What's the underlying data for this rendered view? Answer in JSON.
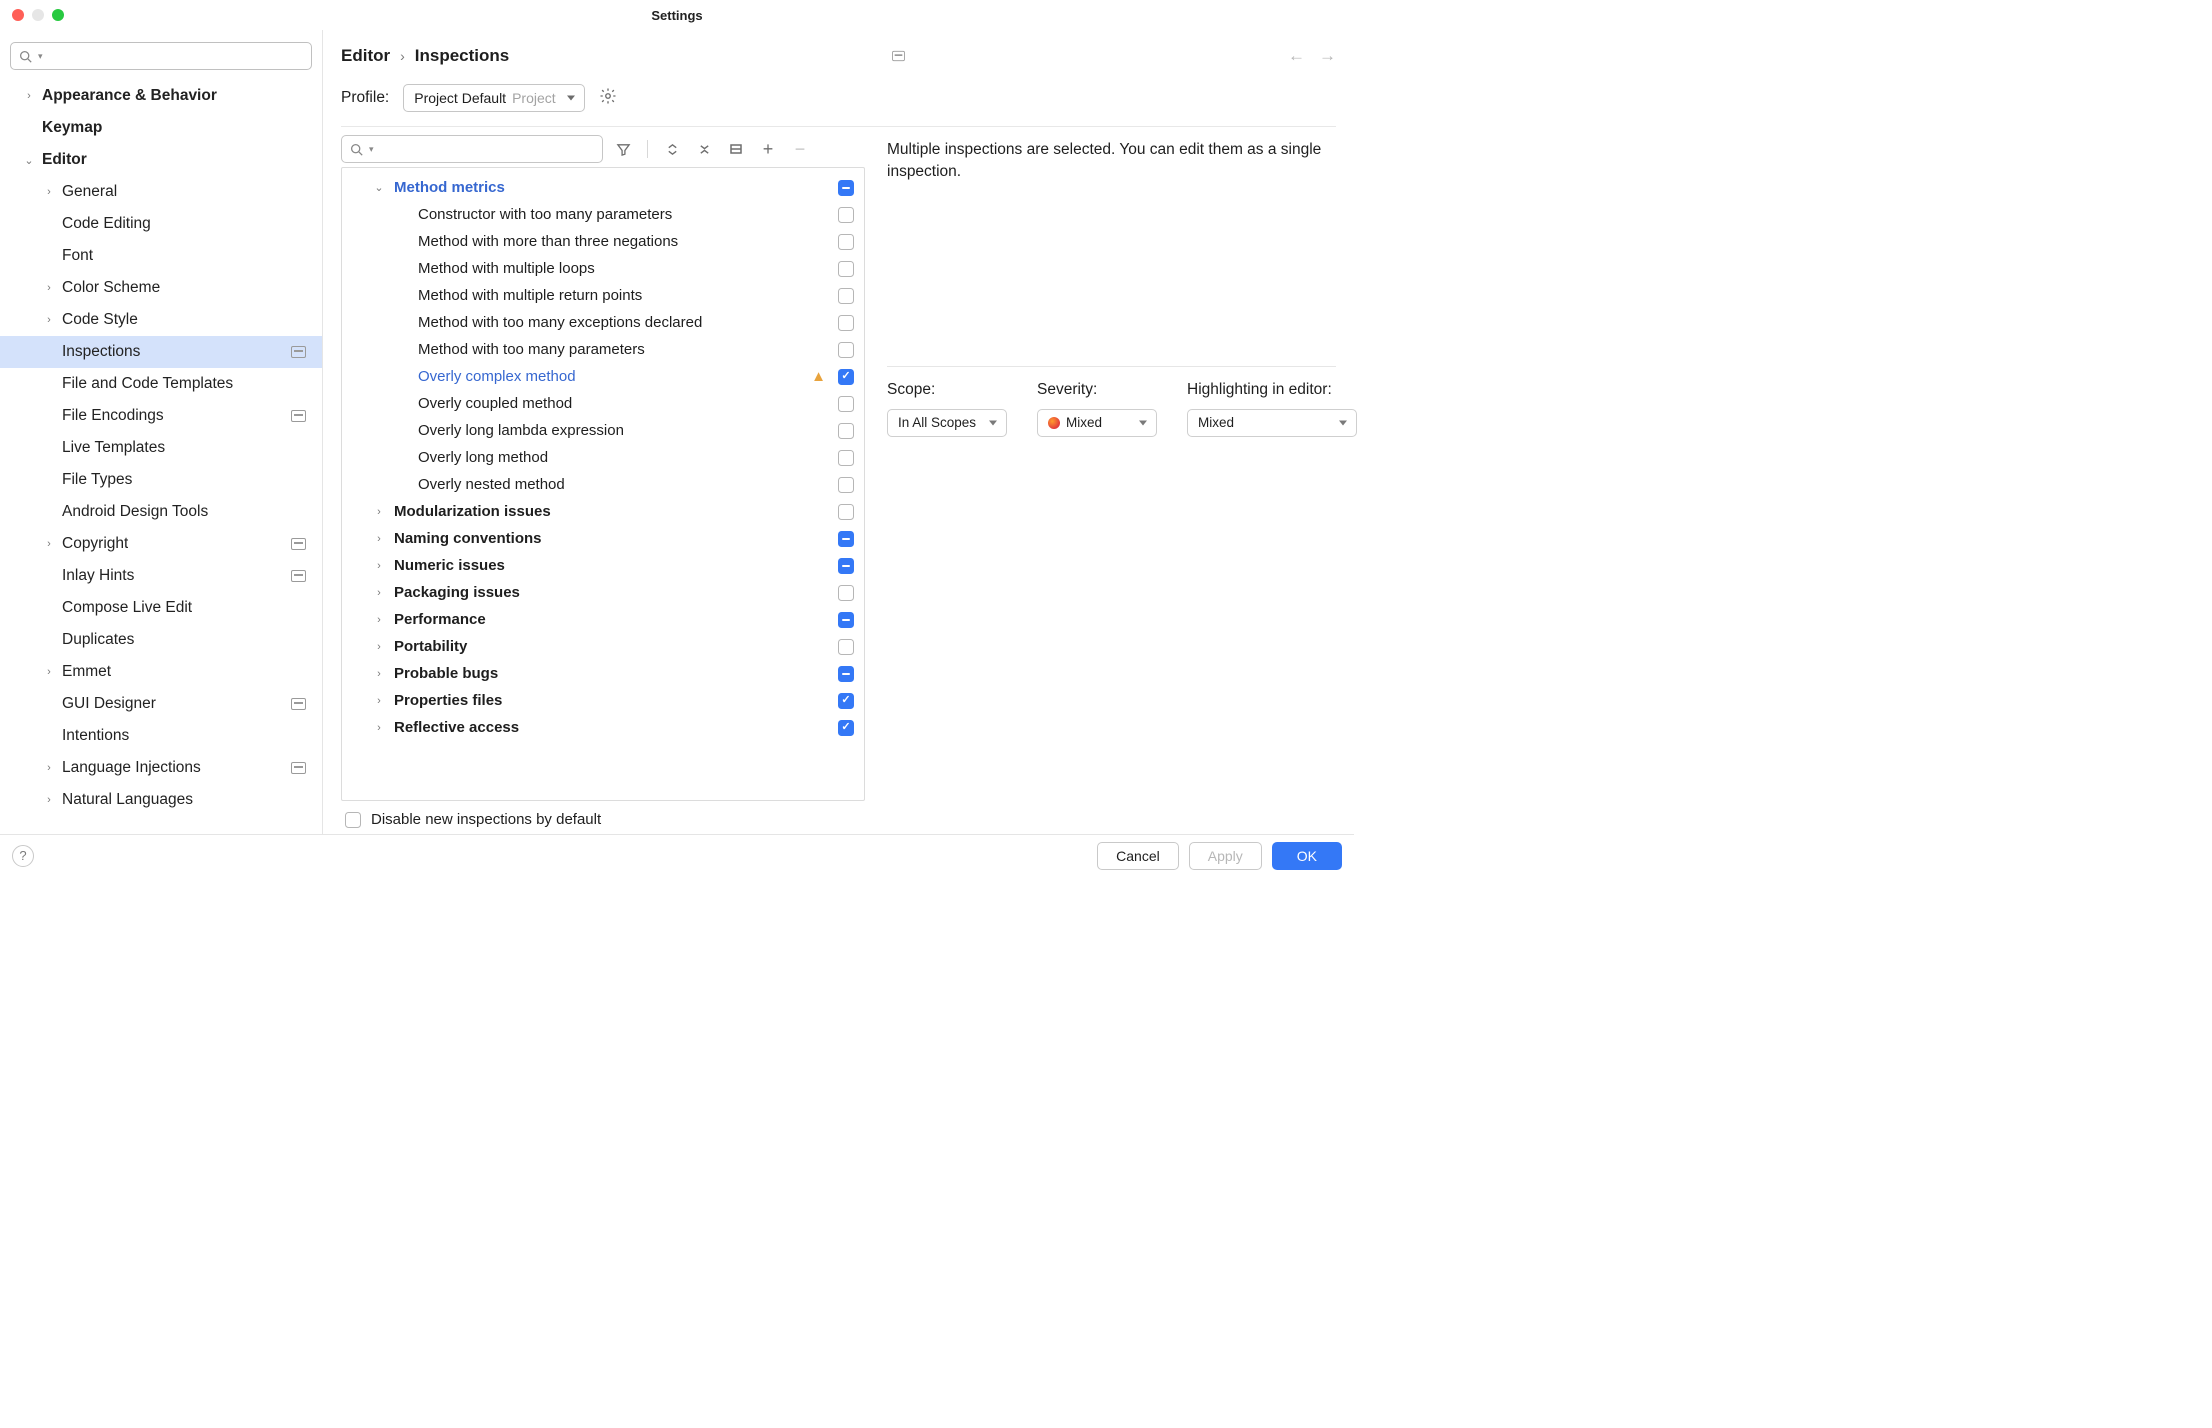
{
  "window": {
    "title": "Settings"
  },
  "sidebar": {
    "search_placeholder": "",
    "items": [
      {
        "label": "Appearance & Behavior",
        "depth": 0,
        "arrow": "right",
        "bold": true
      },
      {
        "label": "Keymap",
        "depth": 0,
        "arrow": "none",
        "bold": true
      },
      {
        "label": "Editor",
        "depth": 0,
        "arrow": "down",
        "bold": true
      },
      {
        "label": "General",
        "depth": 1,
        "arrow": "right"
      },
      {
        "label": "Code Editing",
        "depth": 1,
        "arrow": "none"
      },
      {
        "label": "Font",
        "depth": 1,
        "arrow": "none"
      },
      {
        "label": "Color Scheme",
        "depth": 1,
        "arrow": "right"
      },
      {
        "label": "Code Style",
        "depth": 1,
        "arrow": "right"
      },
      {
        "label": "Inspections",
        "depth": 1,
        "arrow": "none",
        "selected": true,
        "proj": true
      },
      {
        "label": "File and Code Templates",
        "depth": 1,
        "arrow": "none"
      },
      {
        "label": "File Encodings",
        "depth": 1,
        "arrow": "none",
        "proj": true
      },
      {
        "label": "Live Templates",
        "depth": 1,
        "arrow": "none"
      },
      {
        "label": "File Types",
        "depth": 1,
        "arrow": "none"
      },
      {
        "label": "Android Design Tools",
        "depth": 1,
        "arrow": "none"
      },
      {
        "label": "Copyright",
        "depth": 1,
        "arrow": "right",
        "proj": true
      },
      {
        "label": "Inlay Hints",
        "depth": 1,
        "arrow": "none",
        "proj": true
      },
      {
        "label": "Compose Live Edit",
        "depth": 1,
        "arrow": "none"
      },
      {
        "label": "Duplicates",
        "depth": 1,
        "arrow": "none"
      },
      {
        "label": "Emmet",
        "depth": 1,
        "arrow": "right"
      },
      {
        "label": "GUI Designer",
        "depth": 1,
        "arrow": "none",
        "proj": true
      },
      {
        "label": "Intentions",
        "depth": 1,
        "arrow": "none"
      },
      {
        "label": "Language Injections",
        "depth": 1,
        "arrow": "right",
        "proj": true
      },
      {
        "label": "Natural Languages",
        "depth": 1,
        "arrow": "right"
      }
    ]
  },
  "breadcrumb": {
    "a": "Editor",
    "b": "Inspections"
  },
  "profile": {
    "label": "Profile:",
    "value": "Project Default",
    "scope": "Project"
  },
  "inspections_search_placeholder": "",
  "inspections": [
    {
      "label": "Method metrics",
      "kind": "cat",
      "arrow": "down",
      "blue": true,
      "depth": 0,
      "state": "indet"
    },
    {
      "label": "Constructor with too many parameters",
      "depth": 1,
      "state": "off"
    },
    {
      "label": "Method with more than three negations",
      "depth": 1,
      "state": "off"
    },
    {
      "label": "Method with multiple loops",
      "depth": 1,
      "state": "off"
    },
    {
      "label": "Method with multiple return points",
      "depth": 1,
      "state": "off"
    },
    {
      "label": "Method with too many exceptions declared",
      "depth": 1,
      "state": "off"
    },
    {
      "label": "Method with too many parameters",
      "depth": 1,
      "state": "off"
    },
    {
      "label": "Overly complex method",
      "depth": 1,
      "state": "on",
      "blue": true,
      "warn": true
    },
    {
      "label": "Overly coupled method",
      "depth": 1,
      "state": "off"
    },
    {
      "label": "Overly long lambda expression",
      "depth": 1,
      "state": "off"
    },
    {
      "label": "Overly long method",
      "depth": 1,
      "state": "off"
    },
    {
      "label": "Overly nested method",
      "depth": 1,
      "state": "off"
    },
    {
      "label": "Modularization issues",
      "kind": "cat",
      "arrow": "right",
      "depth": 0,
      "state": "off"
    },
    {
      "label": "Naming conventions",
      "kind": "cat",
      "arrow": "right",
      "depth": 0,
      "state": "indet"
    },
    {
      "label": "Numeric issues",
      "kind": "cat",
      "arrow": "right",
      "depth": 0,
      "state": "indet"
    },
    {
      "label": "Packaging issues",
      "kind": "cat",
      "arrow": "right",
      "depth": 0,
      "state": "off"
    },
    {
      "label": "Performance",
      "kind": "cat",
      "arrow": "right",
      "depth": 0,
      "state": "indet"
    },
    {
      "label": "Portability",
      "kind": "cat",
      "arrow": "right",
      "depth": 0,
      "state": "off"
    },
    {
      "label": "Probable bugs",
      "kind": "cat",
      "arrow": "right",
      "depth": 0,
      "state": "indet"
    },
    {
      "label": "Properties files",
      "kind": "cat",
      "arrow": "right",
      "depth": 0,
      "state": "on"
    },
    {
      "label": "Reflective access",
      "kind": "cat",
      "arrow": "right",
      "depth": 0,
      "state": "on"
    }
  ],
  "disable_new_default": {
    "label": "Disable new inspections by default",
    "checked": false
  },
  "detail_message": "Multiple inspections are selected. You can edit them as a single inspection.",
  "controls": {
    "scope": {
      "label": "Scope:",
      "value": "In All Scopes"
    },
    "severity": {
      "label": "Severity:",
      "value": "Mixed"
    },
    "highlighting": {
      "label": "Highlighting in editor:",
      "value": "Mixed"
    }
  },
  "footer": {
    "cancel": "Cancel",
    "apply": "Apply",
    "ok": "OK"
  }
}
